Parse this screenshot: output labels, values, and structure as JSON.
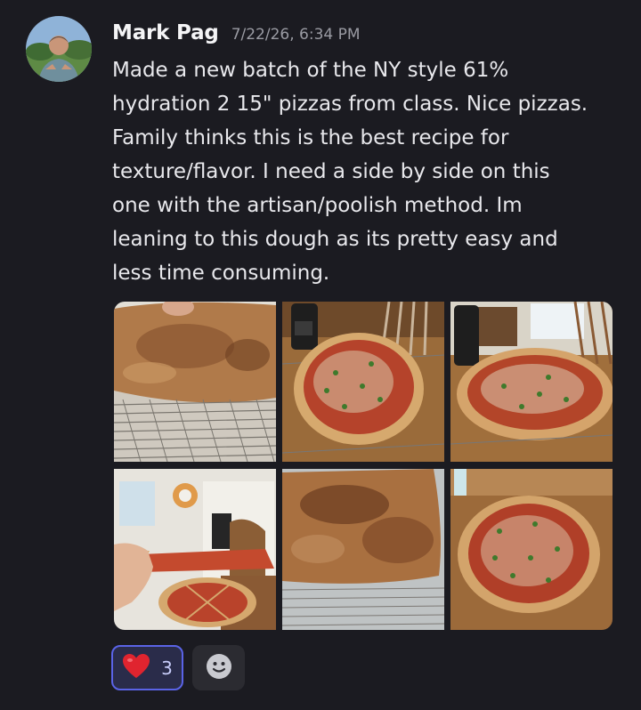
{
  "message": {
    "author": "Mark Pag",
    "timestamp": "7/22/26, 6:34 PM",
    "text_lines": [
      "Made a new batch of the NY style 61%",
      "hydration 2 15\" pizzas from class.  Nice pizzas.",
      "Family thinks this is the best recipe for",
      "texture/flavor. I need a side by side on this",
      "one with the artisan/poolish method.  Im",
      "leaning to this dough as its pretty easy and",
      "less time consuming."
    ]
  },
  "attachments": [
    {
      "label": "pizza-underside-photo"
    },
    {
      "label": "pizza-on-cooling-rack-photo"
    },
    {
      "label": "pizza-on-table-photo"
    },
    {
      "label": "pizza-slice-held-photo"
    },
    {
      "label": "pizza-crust-underside-closeup-photo"
    },
    {
      "label": "pizza-overhead-photo"
    }
  ],
  "reactions": [
    {
      "icon": "heart-icon",
      "emoji": "❤️",
      "count": "3",
      "active": true
    }
  ],
  "add_reaction": {
    "icon": "smiley-icon"
  },
  "colors": {
    "background": "#1b1b21",
    "reaction_active_border": "#5a63e6",
    "reaction_active_bg": "#2a2c4a",
    "timestamp": "#9a9ba3"
  }
}
